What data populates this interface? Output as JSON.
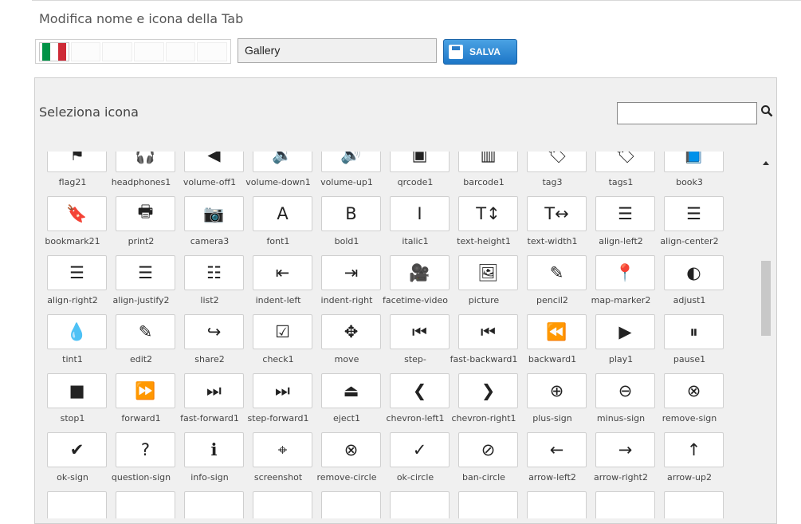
{
  "header": {
    "title": "Modifica nome e icona della Tab"
  },
  "languages": {
    "active": "it",
    "flag_colors": [
      "#009246",
      "#ffffff",
      "#ce2b37"
    ],
    "slots": 6
  },
  "tab_name": {
    "value": "Gallery"
  },
  "save_button": {
    "label": "SALVA",
    "icon": "floppy-icon"
  },
  "icon_panel": {
    "title": "Seleziona icona",
    "search_placeholder": "",
    "search_icon": "search-icon"
  },
  "icons": [
    {
      "label": "flag21",
      "glyph": "⚑"
    },
    {
      "label": "headphones1",
      "glyph": "🎧"
    },
    {
      "label": "volume-off1",
      "glyph": "◀"
    },
    {
      "label": "volume-down1",
      "glyph": "🔉"
    },
    {
      "label": "volume-up1",
      "glyph": "🔊"
    },
    {
      "label": "qrcode1",
      "glyph": "▣"
    },
    {
      "label": "barcode1",
      "glyph": "▥"
    },
    {
      "label": "tag3",
      "glyph": "🏷"
    },
    {
      "label": "tags1",
      "glyph": "🏷"
    },
    {
      "label": "book3",
      "glyph": "📘"
    },
    {
      "label": "bookmark21",
      "glyph": "🔖"
    },
    {
      "label": "print2",
      "glyph": "🖶"
    },
    {
      "label": "camera3",
      "glyph": "📷"
    },
    {
      "label": "font1",
      "glyph": "A"
    },
    {
      "label": "bold1",
      "glyph": "B"
    },
    {
      "label": "italic1",
      "glyph": "I"
    },
    {
      "label": "text-height1",
      "glyph": "T↕"
    },
    {
      "label": "text-width1",
      "glyph": "T↔"
    },
    {
      "label": "align-left2",
      "glyph": "☰"
    },
    {
      "label": "align-center2",
      "glyph": "☰"
    },
    {
      "label": "align-right2",
      "glyph": "☰"
    },
    {
      "label": "align-justify2",
      "glyph": "☰"
    },
    {
      "label": "list2",
      "glyph": "☷"
    },
    {
      "label": "indent-left",
      "glyph": "⇤"
    },
    {
      "label": "indent-right",
      "glyph": "⇥"
    },
    {
      "label": "facetime-video",
      "glyph": "🎥"
    },
    {
      "label": "picture",
      "glyph": "🖼"
    },
    {
      "label": "pencil2",
      "glyph": "✎"
    },
    {
      "label": "map-marker2",
      "glyph": "📍"
    },
    {
      "label": "adjust1",
      "glyph": "◐"
    },
    {
      "label": "tint1",
      "glyph": "💧"
    },
    {
      "label": "edit2",
      "glyph": "✎"
    },
    {
      "label": "share2",
      "glyph": "↪"
    },
    {
      "label": "check1",
      "glyph": "☑"
    },
    {
      "label": "move",
      "glyph": "✥"
    },
    {
      "label": "step-",
      "glyph": "⏮"
    },
    {
      "label": "fast-backward1",
      "glyph": "⏮"
    },
    {
      "label": "backward1",
      "glyph": "⏪"
    },
    {
      "label": "play1",
      "glyph": "▶"
    },
    {
      "label": "pause1",
      "glyph": "⏸"
    },
    {
      "label": "stop1",
      "glyph": "■"
    },
    {
      "label": "forward1",
      "glyph": "⏩"
    },
    {
      "label": "fast-forward1",
      "glyph": "⏭"
    },
    {
      "label": "step-forward1",
      "glyph": "⏭"
    },
    {
      "label": "eject1",
      "glyph": "⏏"
    },
    {
      "label": "chevron-left1",
      "glyph": "❮"
    },
    {
      "label": "chevron-right1",
      "glyph": "❯"
    },
    {
      "label": "plus-sign",
      "glyph": "⊕"
    },
    {
      "label": "minus-sign",
      "glyph": "⊖"
    },
    {
      "label": "remove-sign",
      "glyph": "⊗"
    },
    {
      "label": "ok-sign",
      "glyph": "✔"
    },
    {
      "label": "question-sign",
      "glyph": "?"
    },
    {
      "label": "info-sign",
      "glyph": "ℹ"
    },
    {
      "label": "screenshot",
      "glyph": "⌖"
    },
    {
      "label": "remove-circle",
      "glyph": "⊗"
    },
    {
      "label": "ok-circle",
      "glyph": "✓"
    },
    {
      "label": "ban-circle",
      "glyph": "⊘"
    },
    {
      "label": "arrow-left2",
      "glyph": "←"
    },
    {
      "label": "arrow-right2",
      "glyph": "→"
    },
    {
      "label": "arrow-up2",
      "glyph": "↑"
    }
  ]
}
